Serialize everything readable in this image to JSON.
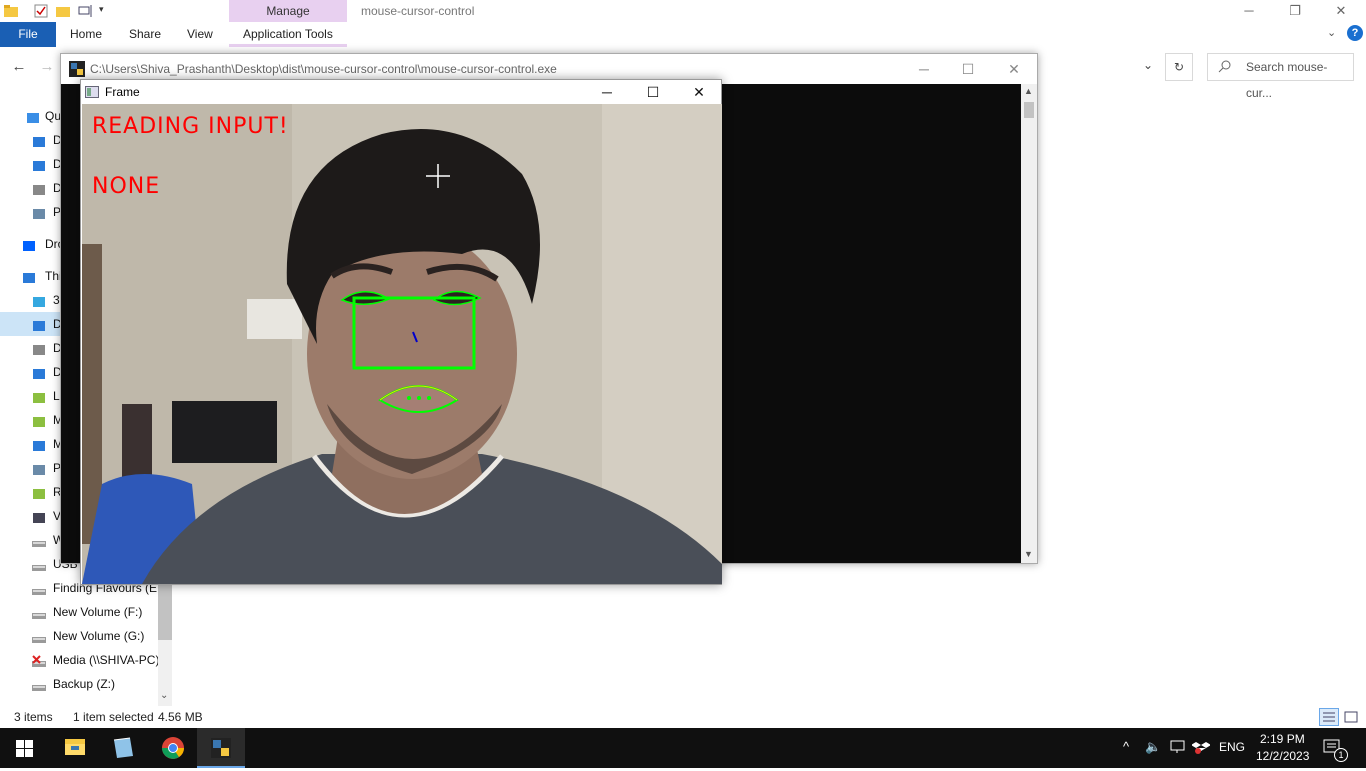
{
  "explorer": {
    "context_tab": "Manage",
    "window_title": "mouse-cursor-control",
    "ribbon_tabs": {
      "file": "File",
      "home": "Home",
      "share": "Share",
      "view": "View",
      "app_tools": "Application Tools"
    },
    "search_placeholder": "Search mouse-cur...",
    "nav_items": [
      {
        "label": "Qu",
        "icon": "star-icon"
      },
      {
        "label": "D",
        "icon": "desktop-icon"
      },
      {
        "label": "D",
        "icon": "download-icon"
      },
      {
        "label": "D",
        "icon": "document-icon"
      },
      {
        "label": "P",
        "icon": "pictures-icon"
      },
      {
        "label": "Dro",
        "icon": "dropbox-icon"
      },
      {
        "label": "Thi",
        "icon": "computer-icon"
      },
      {
        "label": "3",
        "icon": "3d-objects-icon"
      },
      {
        "label": "D",
        "icon": "desktop-icon"
      },
      {
        "label": "D",
        "icon": "document-icon"
      },
      {
        "label": "D",
        "icon": "download-icon"
      },
      {
        "label": "L",
        "icon": "network-folder-icon"
      },
      {
        "label": "M",
        "icon": "network-folder-icon"
      },
      {
        "label": "M",
        "icon": "music-icon"
      },
      {
        "label": "P",
        "icon": "pictures-icon"
      },
      {
        "label": "R",
        "icon": "network-folder-icon"
      },
      {
        "label": "V",
        "icon": "videos-icon"
      },
      {
        "label": "W",
        "icon": "drive-icon"
      },
      {
        "label": "USB D",
        "icon": "drive-icon"
      },
      {
        "label": "Finding Flavours (E:",
        "icon": "drive-icon"
      },
      {
        "label": "New Volume (F:)",
        "icon": "drive-icon"
      },
      {
        "label": "New Volume (G:)",
        "icon": "drive-icon"
      },
      {
        "label": "Media (\\\\SHIVA-PC)",
        "icon": "disconnected-drive-icon"
      },
      {
        "label": "Backup (Z:)",
        "icon": "drive-icon"
      }
    ],
    "status": {
      "items": "3 items",
      "selected": "1 item selected",
      "size": "4.56 MB"
    }
  },
  "console": {
    "title": "C:\\Users\\Shiva_Prashanth\\Desktop\\dist\\mouse-cursor-control\\mouse-cursor-control.exe"
  },
  "frame": {
    "title": "Frame",
    "overlay_line1": "READING INPUT!",
    "overlay_line2": "NONE"
  },
  "taskbar": {
    "language": "ENG",
    "time": "2:19 PM",
    "date": "12/2/2023",
    "notification_count": "1",
    "apps": [
      "file-explorer-icon",
      "notepad-icon",
      "chrome-icon",
      "python-app-icon"
    ]
  },
  "colors": {
    "accent": "#1a5fb4",
    "manage_tab": "#e8d0f0",
    "overlay_text": "#ff0000",
    "landmark_green": "#00ff00"
  }
}
